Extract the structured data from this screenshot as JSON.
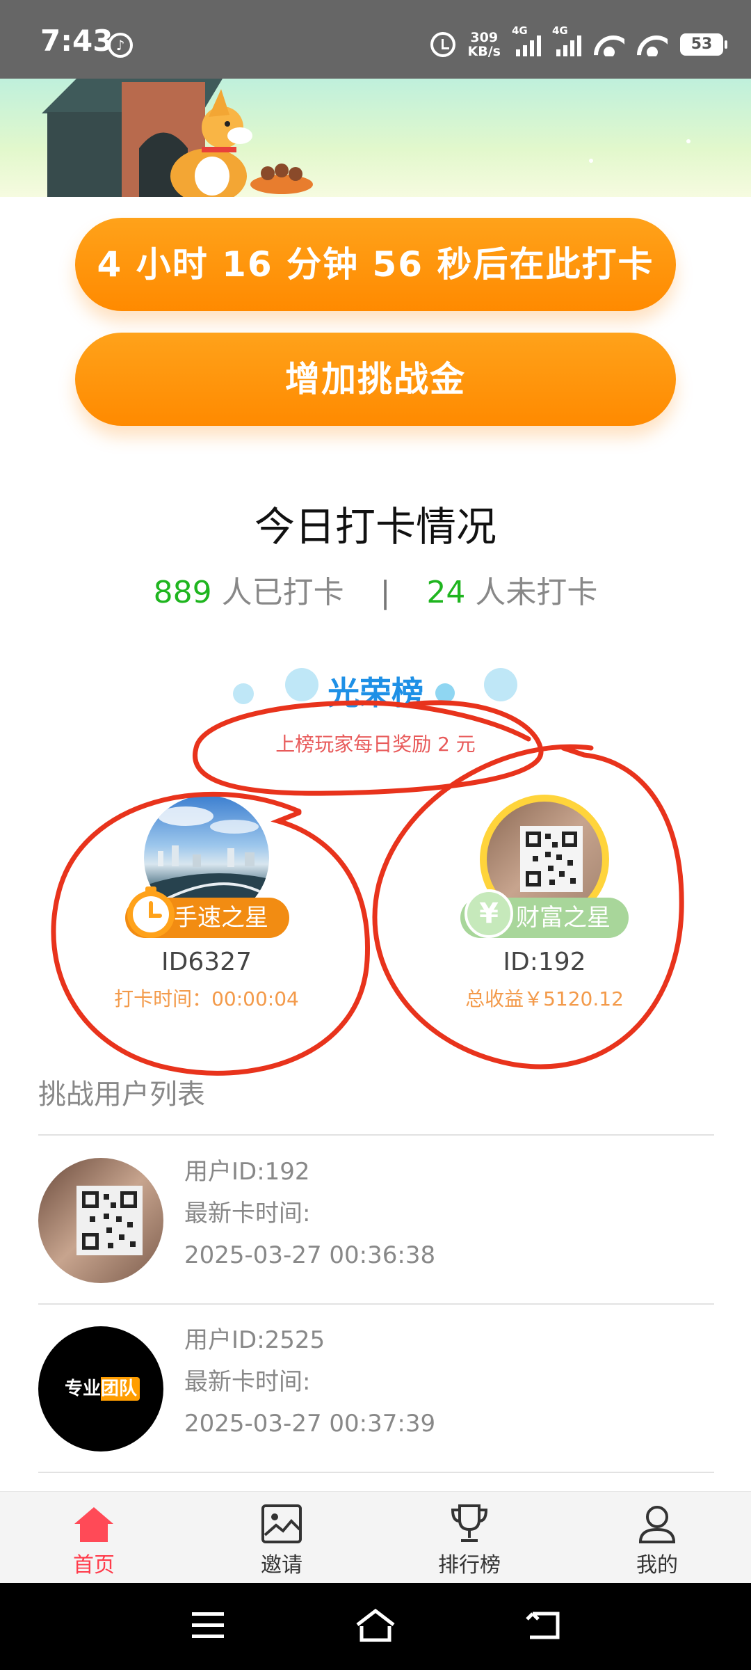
{
  "status_bar": {
    "time": "7:43",
    "net_speed_value": "309",
    "net_speed_unit": "KB/s",
    "signal_label_1": "4G",
    "signal_label_2": "4G",
    "battery": "53"
  },
  "checkin_button": {
    "label": "4 小时 16 分钟 56 秒后在此打卡"
  },
  "add_money_button": {
    "label": "增加挑战金"
  },
  "today": {
    "title": "今日打卡情况",
    "checked_count": "889",
    "checked_label": " 人已打卡",
    "separator": "|",
    "unchecked_count": "24",
    "unchecked_label": " 人未打卡"
  },
  "honor": {
    "title": "光荣榜",
    "subtitle": "上榜玩家每日奖励 2 元",
    "speed_star": {
      "tag": "手速之星",
      "id": "ID6327",
      "meta": "打卡时间：00:00:04"
    },
    "wealth_star": {
      "tag": "财富之星",
      "tag_icon": "¥",
      "id": "ID:192",
      "meta": "总收益￥5120.12"
    }
  },
  "challenge_list": {
    "title": "挑战用户列表",
    "items": [
      {
        "user_id": "用户ID:192",
        "time_label": "最新卡时间:",
        "time": "2025-03-27 00:36:38"
      },
      {
        "user_id": "用户ID:2525",
        "time_label": "最新卡时间:",
        "time": "2025-03-27 00:37:39",
        "avatar_text": "专业团队"
      }
    ]
  },
  "bottom_nav": {
    "items": [
      {
        "label": "首页",
        "icon": "home-icon"
      },
      {
        "label": "邀请",
        "icon": "invite-icon"
      },
      {
        "label": "排行榜",
        "icon": "trophy-icon"
      },
      {
        "label": "我的",
        "icon": "profile-icon"
      }
    ],
    "active_color": "#ff3b4a"
  },
  "colors": {
    "accent_orange": "#ff9a0f",
    "count_green": "#1fb51f",
    "honor_blue": "#1e90e6",
    "reward_red": "#e85a5a",
    "annotation_red": "#e8331c"
  }
}
